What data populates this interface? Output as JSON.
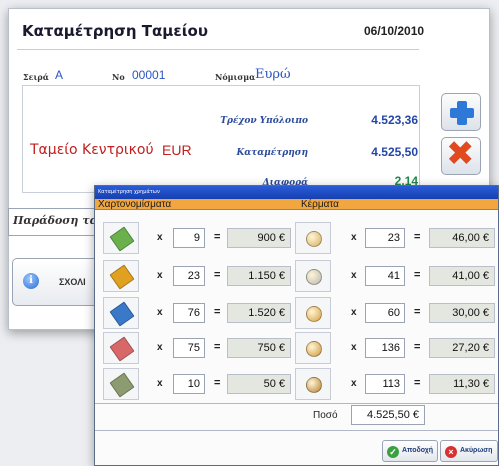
{
  "main": {
    "title": "Καταμέτρηση Ταμείου",
    "date": "06/10/2010",
    "series_label": "Σειρά",
    "series_value": "A",
    "no_label": "Νο",
    "no_value": "00001",
    "currency_label": "Νόμισμα",
    "currency_value": "Ευρώ",
    "cashier_name": "Ταμείο Κεντρικού",
    "cashier_currency": "EUR",
    "balance_label": "Τρέχον Υπόλοιπο",
    "balance_value": "4.523,36",
    "count_label": "Καταμέτρηση",
    "count_value": "4.525,50",
    "diff_label": "Διαφορά",
    "diff_value": "2,14",
    "handover_label": "Παράδοση τα",
    "comments_label": "ΣΧΟΛΙ",
    "add_icon": "plus-icon",
    "cancel_icon": "x-icon",
    "info_icon": "info-icon"
  },
  "dialog": {
    "title": "Καταμέτρηση χρημάτων",
    "notes_header": "Χαρτονομίσματα",
    "coins_header": "Κέρματα",
    "mult_symbol": "x",
    "eq_symbol": "=",
    "notes": [
      {
        "qty": "9",
        "amount": "900 €",
        "color": "#6ab04c"
      },
      {
        "qty": "23",
        "amount": "1.150 €",
        "color": "#e0a020"
      },
      {
        "qty": "76",
        "amount": "1.520 €",
        "color": "#3a78c8"
      },
      {
        "qty": "75",
        "amount": "750 €",
        "color": "#d86868"
      },
      {
        "qty": "10",
        "amount": "50 €",
        "color": "#8c9c70"
      }
    ],
    "coins": [
      {
        "qty": "23",
        "amount": "46,00 €",
        "color": "#d8b060"
      },
      {
        "qty": "41",
        "amount": "41,00 €",
        "color": "#b8b8b0"
      },
      {
        "qty": "60",
        "amount": "30,00 €",
        "color": "#d8a040"
      },
      {
        "qty": "136",
        "amount": "27,20 €",
        "color": "#d09838"
      },
      {
        "qty": "113",
        "amount": "11,30 €",
        "color": "#b88030"
      }
    ],
    "total_label": "Ποσό",
    "total_value": "4.525,50 €",
    "ok_label": "Αποδοχή",
    "cancel_label": "Ακύρωση",
    "ok_icon": "check-icon",
    "cancel_icon": "x-circle-icon"
  }
}
